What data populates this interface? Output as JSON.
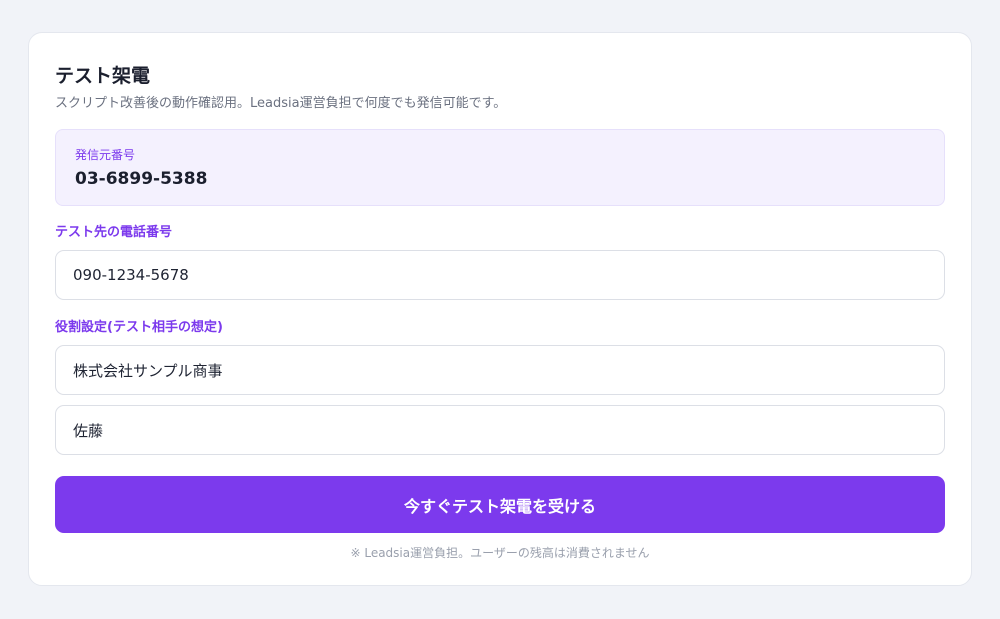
{
  "card": {
    "title": "テスト架電",
    "subtitle": "スクリプト改善後の動作確認用。Leadsia運営負担で何度でも発信可能です。"
  },
  "caller": {
    "label": "発信元番号",
    "number": "03-6899-5388"
  },
  "test_number": {
    "label": "テスト先の電話番号",
    "value": "090-1234-5678"
  },
  "role": {
    "label": "役割設定(テスト相手の想定)",
    "company_value": "株式会社サンプル商事",
    "name_value": "佐藤"
  },
  "submit_label": "今すぐテスト架電を受ける",
  "footnote": "※ Leadsia運営負担。ユーザーの残高は消費されません",
  "colors": {
    "accent": "#7c3aed",
    "background": "#f1f3f8",
    "caller_box": "#f4f1fe"
  }
}
